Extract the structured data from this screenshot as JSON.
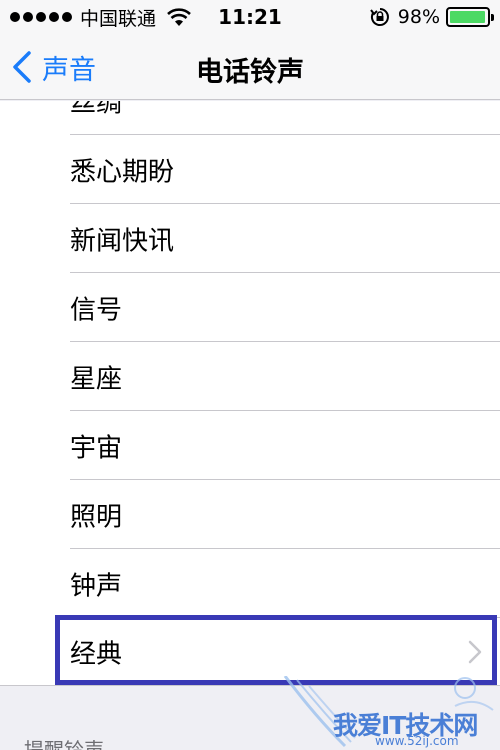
{
  "status_bar": {
    "carrier": "中国联通",
    "time": "11:21",
    "battery_percent": "98%",
    "battery_level": 0.98,
    "signal_bars": 5
  },
  "nav": {
    "back_label": "声音",
    "title": "电话铃声"
  },
  "ringtones": [
    {
      "label": "丝绸"
    },
    {
      "label": "悉心期盼"
    },
    {
      "label": "新闻快讯"
    },
    {
      "label": "信号"
    },
    {
      "label": "星座"
    },
    {
      "label": "宇宙"
    },
    {
      "label": "照明"
    },
    {
      "label": "钟声"
    },
    {
      "label": "经典"
    }
  ],
  "section_header": "提醒铃声",
  "watermark": {
    "text": "我爱IT技术网",
    "url": "www.52ij.com"
  },
  "colors": {
    "accent": "#1a7cfa",
    "battery": "#4cd964",
    "highlight_border": "#3939b5"
  }
}
